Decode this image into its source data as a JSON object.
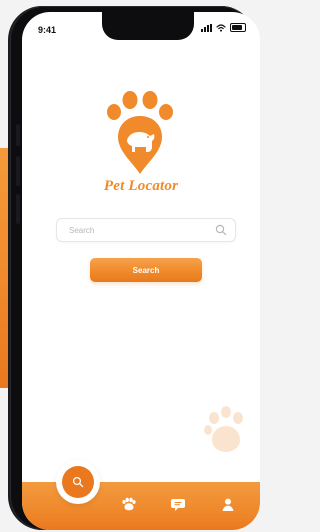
{
  "status_bar": {
    "time": "9:41"
  },
  "brand": {
    "name": "Pet Locator",
    "accent": "#f08a2a"
  },
  "search": {
    "value": "",
    "placeholder": "Search",
    "icon": "search-icon"
  },
  "search_button": {
    "label": "Search"
  },
  "bottom_nav": {
    "items": [
      {
        "name": "search",
        "icon": "search-icon"
      },
      {
        "name": "pets",
        "icon": "paw-icon"
      },
      {
        "name": "messages",
        "icon": "chat-icon"
      },
      {
        "name": "profile",
        "icon": "user-icon"
      }
    ]
  }
}
